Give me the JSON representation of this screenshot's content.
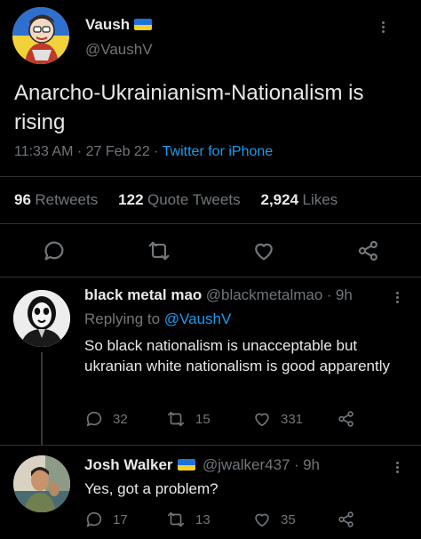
{
  "main_tweet": {
    "author_name": "Vaush",
    "author_handle": "@VaushV",
    "text": "Anarcho-Ukrainianism-Nationalism is rising",
    "time": "11:33 AM",
    "date": "27 Feb 22",
    "source": "Twitter for iPhone",
    "stats": {
      "retweets_count": "96",
      "retweets_label": "Retweets",
      "quotes_count": "122",
      "quotes_label": "Quote Tweets",
      "likes_count": "2,924",
      "likes_label": "Likes"
    }
  },
  "replies": [
    {
      "author_name": "black metal mao",
      "author_handle": "@blackmetalmao",
      "time": "9h",
      "replying_prefix": "Replying to",
      "replying_to": "@VaushV",
      "text": "So black nationalism is unacceptable but ukranian white nationalism is good apparently",
      "reply_count": "32",
      "retweet_count": "15",
      "like_count": "331"
    },
    {
      "author_name": "Josh Walker",
      "author_handle": "@jwalker437",
      "time": "9h",
      "text": "Yes, got a problem?",
      "reply_count": "17",
      "retweet_count": "13",
      "like_count": "35"
    }
  ],
  "colors": {
    "background": "#000000",
    "text": "#e7e9ea",
    "muted": "#71767b",
    "accent": "#1d9bf0",
    "flag_blue": "#1d72d8",
    "flag_yellow": "#f3cf2b"
  },
  "icons": [
    "reply-icon",
    "retweet-icon",
    "like-icon",
    "share-icon",
    "more-icon",
    "ukraine-flag-icon"
  ]
}
